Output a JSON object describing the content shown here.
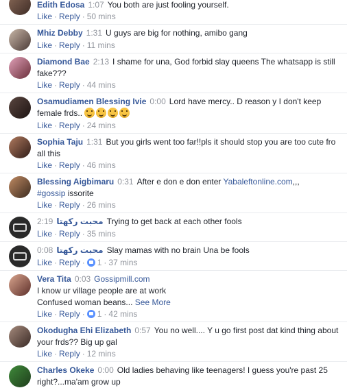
{
  "actions": {
    "like": "Like",
    "reply": "Reply"
  },
  "comments": [
    {
      "name": "Edith Edosa",
      "ts": "1:07",
      "text": "You both are just fooling yourself.",
      "time": "50 mins"
    },
    {
      "name": "Mhiz Debby",
      "ts": "1:31",
      "text": "U guys are big for nothing, amibo gang",
      "time": "11 mins"
    },
    {
      "name": "Diamond Bae",
      "ts": "2:13",
      "text": "I shame for una, God forbid slay queens The whatsapp is still fake???",
      "time": "44 mins"
    },
    {
      "name": "Osamudiamen Blessing Ivie",
      "ts": "0:00",
      "text": "Lord have mercy.. D reason y I don't keep female frds..",
      "time": "24 mins"
    },
    {
      "name": "Sophia Taju",
      "ts": "1:31",
      "text": "But you girls went too far!!pls it should stop you are too cute fro all this",
      "time": "46 mins"
    },
    {
      "name": "Blessing Aigbimaru",
      "ts": "0:31",
      "text": "After e don e don enter",
      "link": "Yabaleftonline.com",
      "after_link": ",,,",
      "hashtag": "#gossip",
      "after_hashtag": "issorite",
      "time": "26 mins"
    },
    {
      "name": "محبت ركهتا",
      "ts": "2:19",
      "text": "Trying to get back at each other fools",
      "time": "35 mins"
    },
    {
      "name": "محبت ركهتا",
      "ts": "0:08",
      "text": "Slay mamas with no brain Una be fools",
      "likes": "1",
      "time": "37 mins"
    },
    {
      "name": "Vera Tita",
      "ts": "0:03",
      "link": "Gossipmill.com",
      "line2": "I know ur village people are at work",
      "line3": "Confused woman beans...",
      "see_more": "See More",
      "likes": "1",
      "time": "42 mins"
    },
    {
      "name": "Okodugha Ehi Elizabeth",
      "ts": "0:57",
      "text": "You no well.... Y u go first post dat kind thing about your frds?? Big up gal",
      "time": "12 mins"
    },
    {
      "name": "Charles Okeke",
      "ts": "0:00",
      "text": "Old ladies behaving like teenagers! I guess you're past 25 right?...ma'am grow up"
    }
  ]
}
